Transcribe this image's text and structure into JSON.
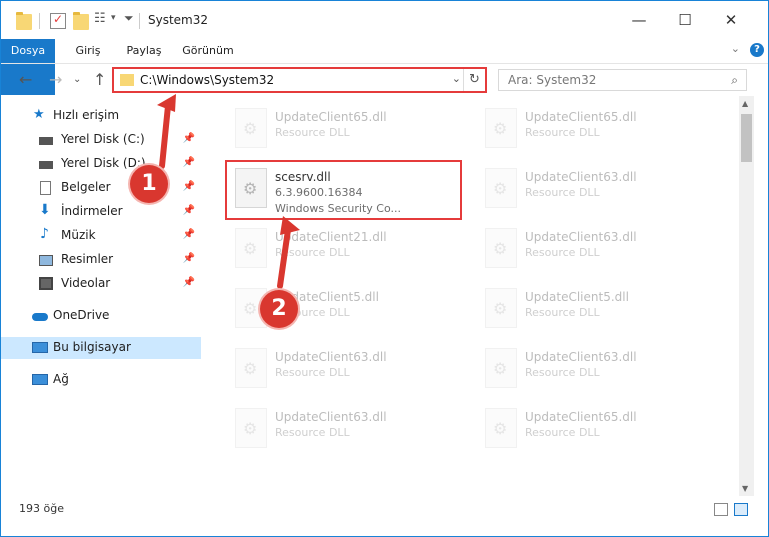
{
  "window": {
    "title": "System32",
    "controls": {
      "minimize": "—",
      "maximize": "☐",
      "close": "✕"
    }
  },
  "ribbon": {
    "tabs": [
      "Dosya",
      "Giriş",
      "Paylaş",
      "Görünüm"
    ],
    "help": "?"
  },
  "nav": {
    "address": "C:\\Windows\\System32",
    "search_placeholder": "Ara: System32"
  },
  "sidebar": {
    "items": [
      {
        "label": "Hızlı erişim",
        "icon": "star-icon"
      },
      {
        "label": "Yerel Disk (C:)",
        "icon": "drive-icon",
        "pinned": true
      },
      {
        "label": "Yerel Disk (D:)",
        "icon": "drive-icon",
        "pinned": true
      },
      {
        "label": "Belgeler",
        "icon": "document-icon",
        "pinned": true
      },
      {
        "label": "İndirmeler",
        "icon": "download-icon",
        "pinned": true
      },
      {
        "label": "Müzik",
        "icon": "music-icon",
        "pinned": true
      },
      {
        "label": "Resimler",
        "icon": "pictures-icon",
        "pinned": true
      },
      {
        "label": "Videolar",
        "icon": "videos-icon",
        "pinned": true
      },
      {
        "label": "OneDrive",
        "icon": "cloud-icon"
      },
      {
        "label": "Bu bilgisayar",
        "icon": "computer-icon"
      },
      {
        "label": "Ağ",
        "icon": "network-icon"
      }
    ]
  },
  "files": {
    "selected": {
      "name": "scesrv.dll",
      "version": "6.3.9600.16384",
      "description": "Windows Security Co..."
    },
    "left": [
      {
        "name": "UpdateClient65.dll",
        "type": "Resource DLL"
      },
      {
        "name": "UpdateClient21.dll",
        "type": "Resource DLL"
      },
      {
        "name": "UpdateClient5.dll",
        "type": "Resource DLL"
      },
      {
        "name": "UpdateClient63.dll",
        "type": "Resource DLL"
      },
      {
        "name": "UpdateClient63.dll",
        "type": "Resource DLL"
      }
    ],
    "right": [
      {
        "name": "UpdateClient65.dll",
        "type": "Resource DLL"
      },
      {
        "name": "UpdateClient63.dll",
        "type": "Resource DLL"
      },
      {
        "name": "UpdateClient63.dll",
        "type": "Resource DLL"
      },
      {
        "name": "UpdateClient5.dll",
        "type": "Resource DLL"
      },
      {
        "name": "UpdateClient63.dll",
        "type": "Resource DLL"
      },
      {
        "name": "UpdateClient65.dll",
        "type": "Resource DLL"
      }
    ]
  },
  "status": {
    "count": "193 öğe"
  },
  "annotations": {
    "step1": "1",
    "step2": "2",
    "color": "#d9372f"
  }
}
